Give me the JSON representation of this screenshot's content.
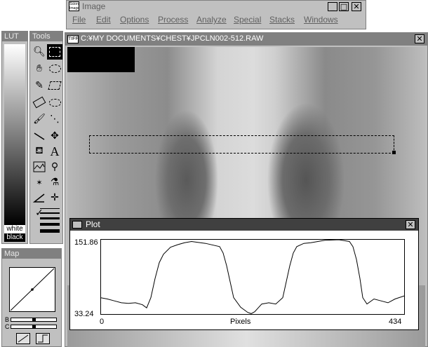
{
  "image_window": {
    "title": "Image",
    "icon_text": "Scion Image",
    "menu": [
      "File",
      "Edit",
      "Options",
      "Process",
      "Analyze",
      "Special",
      "Stacks",
      "Windows"
    ]
  },
  "lut_panel": {
    "title": "LUT",
    "white_label": "white",
    "black_label": "black"
  },
  "tools_panel": {
    "title": "Tools"
  },
  "map_panel": {
    "title": "Map",
    "b_label": "B",
    "c_label": "C"
  },
  "doc_window": {
    "badge": "TIFF",
    "title": "C:¥MY DOCUMENTS¥CHEST¥JPCLN002-512.RAW"
  },
  "plot_window": {
    "title": "Plot",
    "ymax_label": "151.86",
    "ymin_label": "33.24",
    "x_start_label": "0",
    "x_end_label": "434",
    "xlabel": "Pixels"
  },
  "chart_data": {
    "type": "line",
    "xlabel": "Pixels",
    "xlim": [
      0,
      434
    ],
    "ylim": [
      33.24,
      151.86
    ],
    "series": [
      {
        "x": [
          0,
          10,
          20,
          30,
          40,
          50,
          60,
          66,
          72,
          78,
          84,
          90,
          100,
          110,
          120,
          130,
          150,
          170,
          175,
          180,
          185,
          190,
          200,
          210,
          215,
          220,
          225,
          230,
          240,
          250,
          260,
          265,
          270,
          275,
          280,
          290,
          300,
          310,
          320,
          340,
          355,
          360,
          365,
          370,
          374,
          380,
          390,
          400,
          410,
          420,
          434
        ],
        "y": [
          60,
          58,
          55,
          52,
          51,
          52,
          49,
          44,
          60,
          90,
          115,
          128,
          139,
          143,
          146,
          148,
          145,
          140,
          130,
          110,
          85,
          60,
          45,
          37,
          35,
          38,
          44,
          50,
          52,
          50,
          60,
          85,
          110,
          130,
          140,
          145,
          146,
          148,
          150,
          152,
          148,
          140,
          120,
          90,
          60,
          50,
          58,
          55,
          52,
          58,
          63
        ]
      }
    ]
  }
}
